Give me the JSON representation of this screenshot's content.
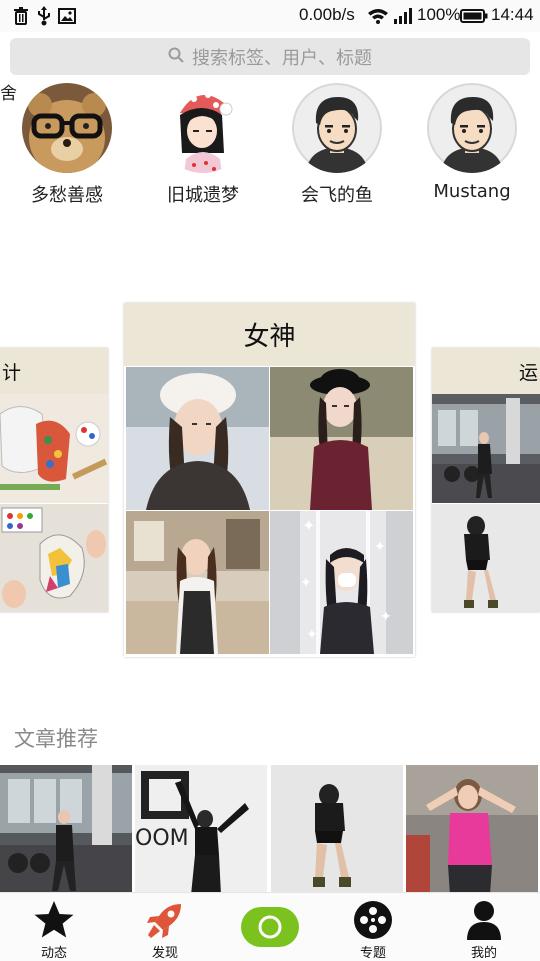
{
  "status": {
    "icons": [
      "trash-icon",
      "usb-icon",
      "image-icon",
      "wifi-icon",
      "signal-icon",
      "battery-icon"
    ],
    "speed": "0.00b/s",
    "battery": "100%",
    "time": "14:44"
  },
  "search": {
    "placeholder": "搜索标签、用户、标题",
    "icon": "search-icon"
  },
  "users": {
    "edge_char": "舍",
    "items": [
      {
        "name": "多愁善感",
        "avatar": "teddy-bear-glasses-avatar"
      },
      {
        "name": "旧城遗梦",
        "avatar": "cartoon-girl-avatar"
      },
      {
        "name": "会飞的鱼",
        "avatar": "cartoon-man-avatar"
      },
      {
        "name": "Mustang",
        "avatar": "cartoon-man-avatar"
      }
    ]
  },
  "topics": {
    "left_label": "计",
    "center_label": "女神",
    "right_label": "运"
  },
  "articles": {
    "title": "文章推荐"
  },
  "tabs": {
    "dynamics": "动态",
    "discover": "发现",
    "topics": "专题",
    "mine": "我的"
  },
  "colors": {
    "accent": "#7cc21e",
    "card_header": "#ebe6d6",
    "discover_icon": "#e0553a"
  }
}
